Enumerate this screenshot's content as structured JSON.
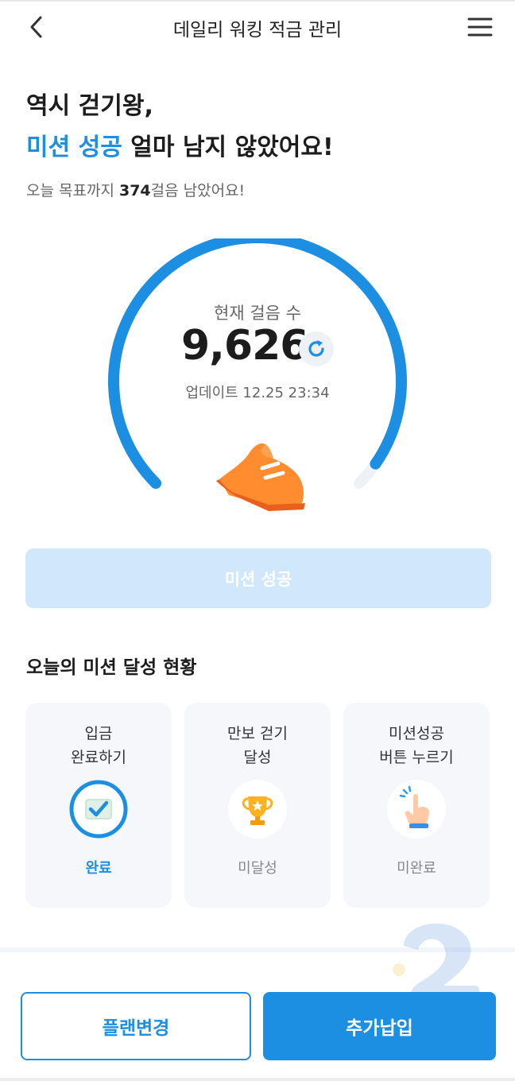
{
  "header": {
    "title": "데일리 워킹 적금 관리",
    "back_icon": "chevron-left-icon",
    "menu_icon": "hamburger-menu-icon"
  },
  "headline": {
    "line1": "역시 걷기왕,",
    "line2_accent": "미션 성공",
    "line2_rest": " 얼마 남지 않았어요!"
  },
  "subtitle": {
    "prefix": "오늘 목표까지 ",
    "steps_left": "374",
    "suffix": "걸음 남았어요!"
  },
  "gauge": {
    "label": "현재 걸음 수",
    "value": "9,626",
    "update": "업데이트 12.25 23:34",
    "progress": 0.9626,
    "refresh_icon": "refresh-icon",
    "shoe_icon": "sneaker-icon"
  },
  "mission_button": {
    "label": "미션 성공"
  },
  "section_title": "오늘의 미션 달성 현황",
  "cards": [
    {
      "title": "입금\n완료하기",
      "status": "완료",
      "icon": "check-icon"
    },
    {
      "title": "만보 걷기\n달성",
      "status": "미달성",
      "icon": "trophy-icon"
    },
    {
      "title": "미션성공\n버튼 누르기",
      "status": "미완료",
      "icon": "tap-hand-icon"
    }
  ],
  "footer": {
    "plan_label": "플랜변경",
    "add_label": "추가납입"
  },
  "colors": {
    "accent": "#1d8fe3",
    "disabled_button": "#d1e7fb",
    "card_bg": "#f5f7fa",
    "gauge_track": "#eef2f6"
  }
}
